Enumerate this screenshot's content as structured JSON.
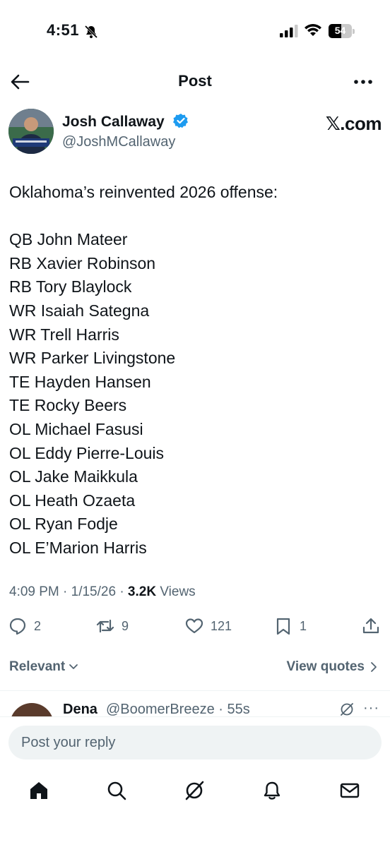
{
  "status_bar": {
    "time": "4:51",
    "battery_level": "54",
    "battery_percent": 54
  },
  "header": {
    "title": "Post",
    "back_icon": "arrow-left-icon",
    "more_icon": "more-horizontal-icon"
  },
  "post": {
    "author_name": "Josh Callaway",
    "author_handle": "@JoshMCallaway",
    "verified": true,
    "source": "𝕏.com",
    "intro": "Oklahoma’s reinvented 2026 offense:",
    "lines": [
      "QB John Mateer",
      "RB Xavier Robinson",
      "RB Tory Blaylock",
      "WR Isaiah Sategna",
      "WR Trell Harris",
      "WR Parker Livingstone",
      "TE Hayden Hansen",
      "TE Rocky Beers",
      "OL Michael Fasusi",
      "OL Eddy Pierre-Louis",
      "OL Jake Maikkula",
      "OL Heath Ozaeta",
      "OL Ryan Fodje",
      "OL E’Marion Harris"
    ],
    "timestamp": "4:09 PM · 1/15/26 · ",
    "views_count": "3.2K",
    "views_label": " Views"
  },
  "actions": {
    "replies": "2",
    "reposts": "9",
    "likes": "121",
    "bookmarks": "1"
  },
  "filters": {
    "sort_label": "Relevant",
    "quotes_label": "View quotes"
  },
  "reply_preview": {
    "name": "Dena",
    "handle": "@BoomerBreeze · 55s"
  },
  "composer": {
    "placeholder": "Post your reply"
  },
  "tabs": [
    "home-icon",
    "search-icon",
    "grok-icon",
    "notifications-icon",
    "messages-icon"
  ],
  "colors": {
    "text": "#0f1419",
    "secondary": "#536471",
    "verified": "#1d9bf0",
    "input_bg": "#eff3f4"
  }
}
